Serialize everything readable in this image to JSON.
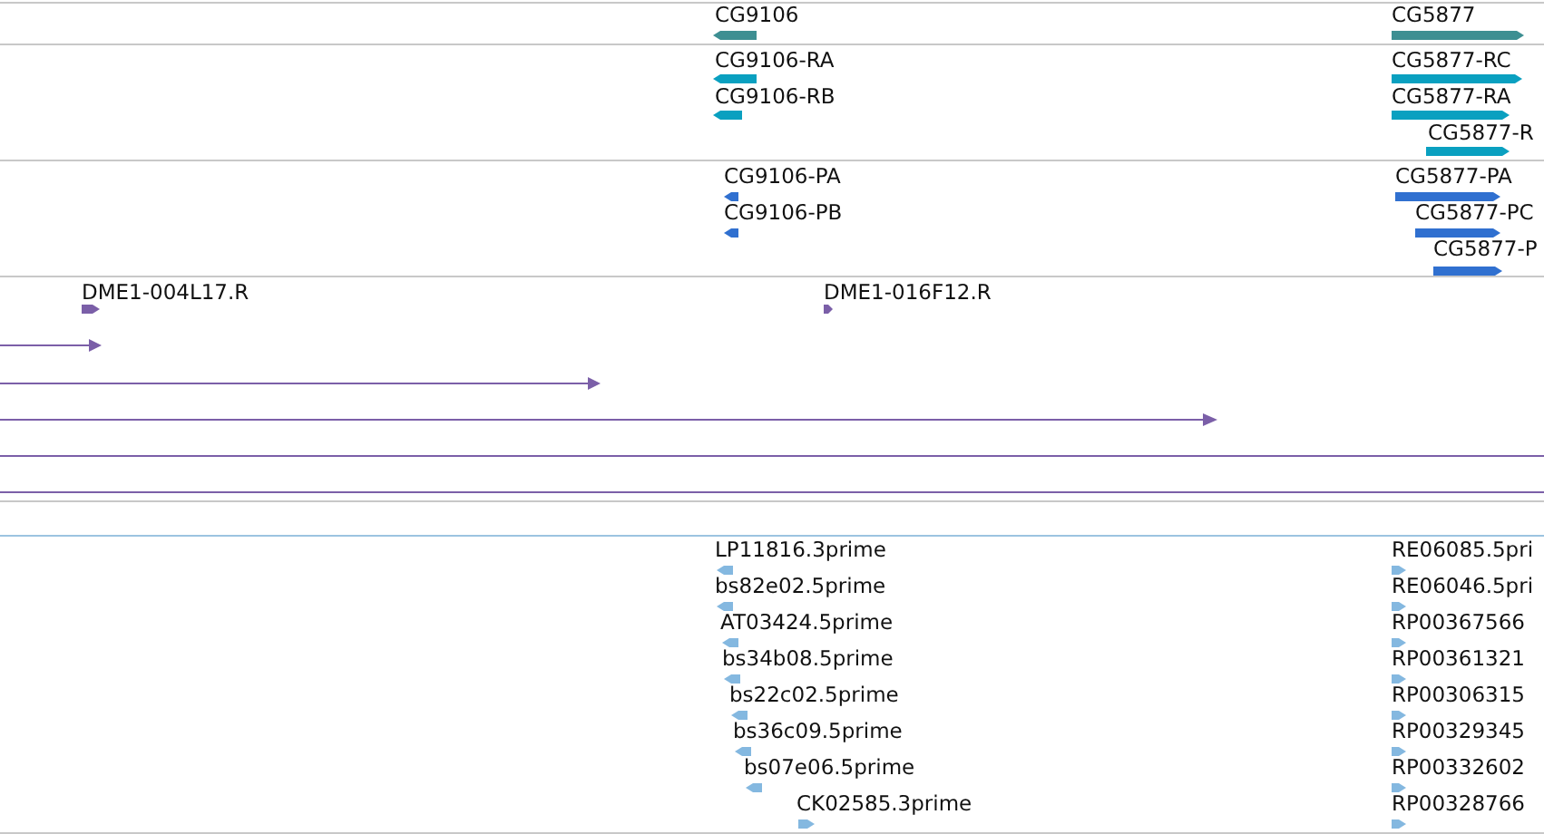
{
  "tracks": [
    {
      "color": "#3d8f92",
      "features": [
        {
          "label": "CG9106",
          "kind": "reverse"
        },
        {
          "label": "CG5877",
          "kind": "forward"
        }
      ]
    },
    {
      "color": "#0aa0c0",
      "features": [
        {
          "label": "CG9106-RA",
          "kind": "reverse"
        },
        {
          "label": "CG9106-RB",
          "kind": "reverse"
        },
        {
          "label": "CG5877-RC",
          "kind": "forward"
        },
        {
          "label": "CG5877-RA",
          "kind": "forward"
        },
        {
          "label": "CG5877-R",
          "kind": "forward"
        }
      ]
    },
    {
      "color": "#3070d0",
      "features": [
        {
          "label": "CG9106-PA",
          "kind": "reverse"
        },
        {
          "label": "CG9106-PB",
          "kind": "reverse"
        },
        {
          "label": "CG5877-PA",
          "kind": "forward"
        },
        {
          "label": "CG5877-PC",
          "kind": "forward"
        },
        {
          "label": "CG5877-P",
          "kind": "forward"
        }
      ]
    },
    {
      "color": "#7b5fa8",
      "features": [
        {
          "label": "DME1-004L17.R",
          "kind": "forward"
        },
        {
          "label": "DME1-016F12.R",
          "kind": "forward"
        },
        {
          "kind": "forward"
        },
        {
          "kind": "forward"
        },
        {
          "kind": "forward"
        },
        {
          "kind": "forward"
        },
        {
          "kind": "forward"
        }
      ]
    },
    {
      "color": "#84b8e0",
      "features": [
        {
          "label": "LP11816.3prime",
          "kind": "reverse"
        },
        {
          "label": "bs82e02.5prime",
          "kind": "reverse"
        },
        {
          "label": "AT03424.5prime",
          "kind": "reverse"
        },
        {
          "label": "bs34b08.5prime",
          "kind": "reverse"
        },
        {
          "label": "bs22c02.5prime",
          "kind": "reverse"
        },
        {
          "label": "bs36c09.5prime",
          "kind": "reverse"
        },
        {
          "label": "bs07e06.5prime",
          "kind": "reverse"
        },
        {
          "label": "CK02585.3prime",
          "kind": "forward"
        },
        {
          "label": "RE06085.5pri",
          "kind": "forward"
        },
        {
          "label": "RE06046.5pri",
          "kind": "forward"
        },
        {
          "label": "RP00367566",
          "kind": "forward"
        },
        {
          "label": "RP00361321",
          "kind": "forward"
        },
        {
          "label": "RP00306315",
          "kind": "forward"
        },
        {
          "label": "RP00329345",
          "kind": "forward"
        },
        {
          "label": "RP00332602",
          "kind": "forward"
        },
        {
          "label": "RP00328766",
          "kind": "forward"
        }
      ]
    }
  ]
}
